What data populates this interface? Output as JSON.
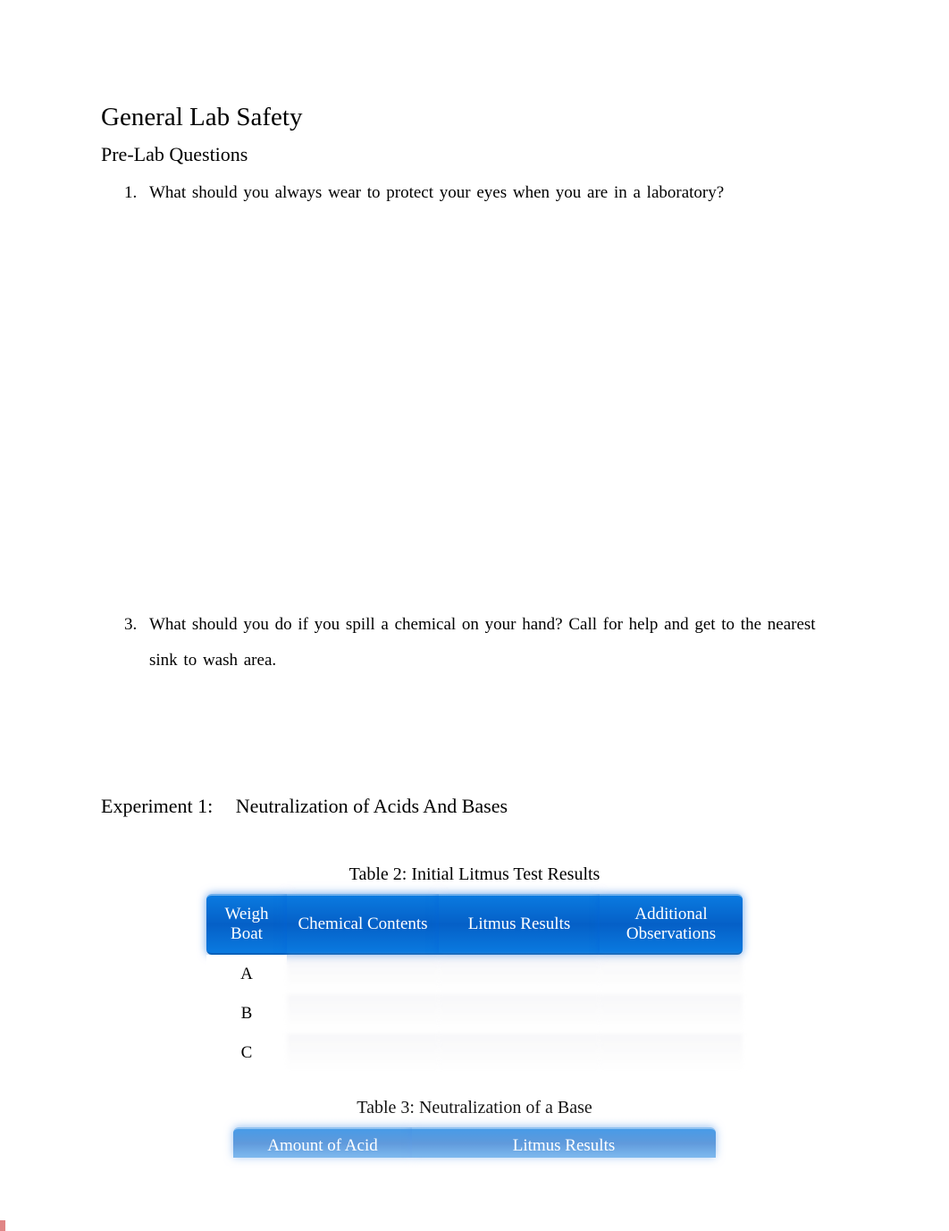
{
  "title": "General Lab Safety",
  "sectionTitle": "Pre-Lab Questions",
  "questions": {
    "q1": {
      "number": "1.",
      "text": "What should you always wear to protect your eyes when you are in a laboratory?"
    },
    "q3": {
      "number": "3.",
      "text": "What should you do if you spill a chemical on your hand? Call for help and get to the nearest sink to wash area."
    }
  },
  "experiment": {
    "label": "Experiment 1:",
    "title": "Neutralization of Acids And Bases"
  },
  "table2": {
    "title": "Table 2: Initial Litmus Test Results",
    "headers": {
      "weighBoat": "Weigh Boat",
      "chemical": "Chemical Contents",
      "litmus": "Litmus Results",
      "observations": "Additional Observations"
    },
    "rows": [
      {
        "weighBoat": "A",
        "chemical": "",
        "litmus": "",
        "observations": ""
      },
      {
        "weighBoat": "B",
        "chemical": "",
        "litmus": "",
        "observations": ""
      },
      {
        "weighBoat": "C",
        "chemical": "",
        "litmus": "",
        "observations": ""
      }
    ]
  },
  "table3": {
    "title": "Table 3: Neutralization of a Base",
    "headers": {
      "amountAcid": "Amount of Acid",
      "litmus": "Litmus Results"
    }
  }
}
